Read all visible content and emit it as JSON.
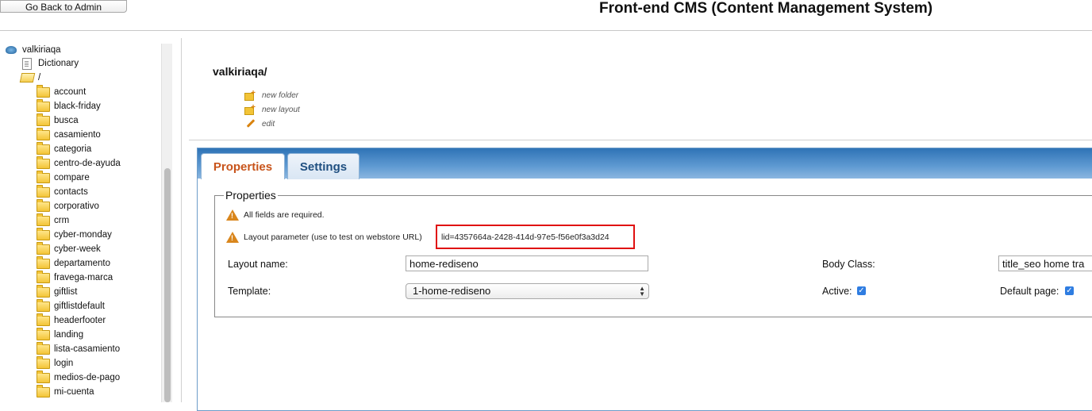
{
  "header": {
    "back_label": "Go Back to Admin",
    "title": "Front-end CMS (Content Management System)"
  },
  "sidebar": {
    "root": "valkiriaqa",
    "items": [
      {
        "label": "Dictionary",
        "icon": "document-icon"
      },
      {
        "label": "/",
        "icon": "folder-open-icon"
      },
      {
        "label": "account",
        "icon": "folder-icon"
      },
      {
        "label": "black-friday",
        "icon": "folder-icon"
      },
      {
        "label": "busca",
        "icon": "folder-icon"
      },
      {
        "label": "casamiento",
        "icon": "folder-icon"
      },
      {
        "label": "categoria",
        "icon": "folder-icon"
      },
      {
        "label": "centro-de-ayuda",
        "icon": "folder-icon"
      },
      {
        "label": "compare",
        "icon": "folder-icon"
      },
      {
        "label": "contacts",
        "icon": "folder-icon"
      },
      {
        "label": "corporativo",
        "icon": "folder-icon"
      },
      {
        "label": "crm",
        "icon": "folder-icon"
      },
      {
        "label": "cyber-monday",
        "icon": "folder-icon"
      },
      {
        "label": "cyber-week",
        "icon": "folder-icon"
      },
      {
        "label": "departamento",
        "icon": "folder-icon"
      },
      {
        "label": "fravega-marca",
        "icon": "folder-icon"
      },
      {
        "label": "giftlist",
        "icon": "folder-icon"
      },
      {
        "label": "giftlistdefault",
        "icon": "folder-icon"
      },
      {
        "label": "headerfooter",
        "icon": "folder-icon"
      },
      {
        "label": "landing",
        "icon": "folder-icon"
      },
      {
        "label": "lista-casamiento",
        "icon": "folder-icon"
      },
      {
        "label": "login",
        "icon": "folder-icon"
      },
      {
        "label": "medios-de-pago",
        "icon": "folder-icon"
      },
      {
        "label": "mi-cuenta",
        "icon": "folder-icon"
      }
    ]
  },
  "main": {
    "folder_title": "valkiriaqa/",
    "actions": {
      "new_folder": "new folder",
      "new_layout": "new layout",
      "edit": "edit"
    },
    "tabs": {
      "properties": "Properties",
      "settings": "Settings"
    },
    "properties": {
      "legend": "Properties",
      "warning_required": "All fields are required.",
      "warning_layout_param": "Layout parameter (use to test on webstore URL)",
      "lid": "lid=4357664a-2428-414d-97e5-f56e0f3a3d24",
      "layout_name_label": "Layout name:",
      "layout_name_value": "home-rediseno",
      "body_class_label": "Body Class:",
      "body_class_value": "title_seo home tra",
      "template_label": "Template:",
      "template_value": "1-home-rediseno",
      "active_label": "Active:",
      "active_checked": true,
      "default_page_label": "Default page:",
      "default_page_checked": true
    }
  },
  "colors": {
    "tab_bar": "#2f73b6",
    "active_tab_text": "#c8541b",
    "highlight_border": "#e01010",
    "warning": "#d9861c",
    "checkbox": "#2f7de1"
  }
}
